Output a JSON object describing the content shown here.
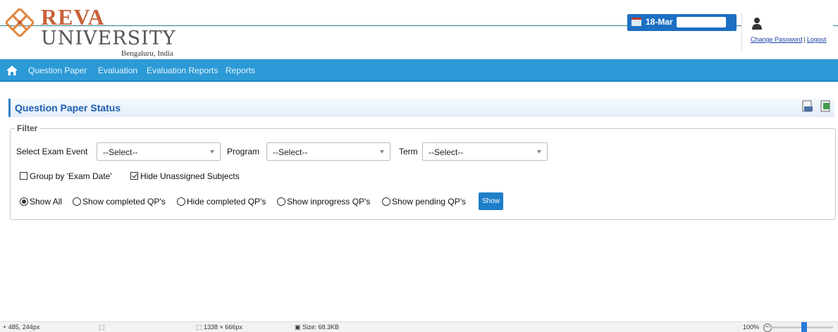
{
  "header": {
    "logo_title": "REVA",
    "logo_subtitle": "UNIVERSITY",
    "logo_location": "Bengaluru, India",
    "date_text": "18-Mar",
    "user_links": {
      "change_password": "Change Password",
      "separator": "|",
      "logout": "Logout"
    }
  },
  "nav": {
    "items": [
      {
        "label": "Question Paper"
      },
      {
        "label": "Evaluation"
      },
      {
        "label": "Evaluation Reports"
      },
      {
        "label": "Reports"
      }
    ]
  },
  "panel": {
    "title": "Question Paper Status",
    "filter_legend": "Filter",
    "exam_event": {
      "label": "Select Exam Event",
      "value": "--Select--"
    },
    "program": {
      "label": "Program",
      "value": "--Select--"
    },
    "term": {
      "label": "Term",
      "value": "--Select--"
    },
    "checkboxes": [
      {
        "label": "Group by 'Exam Date'",
        "checked": false
      },
      {
        "label": "Hide Unassigned Subjects",
        "checked": true
      }
    ],
    "radios": [
      {
        "label": "Show All",
        "selected": true
      },
      {
        "label": "Show completed QP's",
        "selected": false
      },
      {
        "label": "Hide completed QP's",
        "selected": false
      },
      {
        "label": "Show inprogress QP's",
        "selected": false
      },
      {
        "label": "Show pending QP's",
        "selected": false
      }
    ],
    "show_button": "Show"
  },
  "statusbar": {
    "cursor_pos": "485, 244px",
    "dimensions": "1338 × 666px",
    "size": "Size: 68.3KB",
    "zoom": "100%"
  },
  "colors": {
    "nav_bg": "#2c9ad6",
    "title_blue": "#1d5fae",
    "logo_orange": "#c8623a",
    "button_blue": "#1d7fc9"
  }
}
